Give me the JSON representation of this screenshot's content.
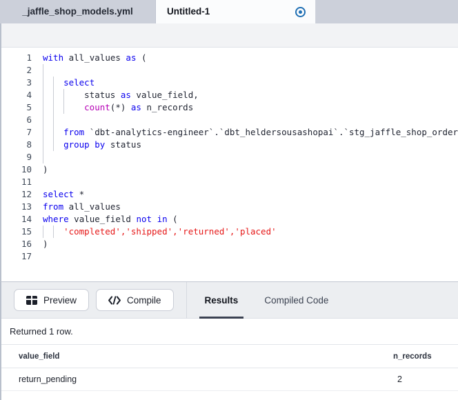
{
  "tabs": [
    {
      "label": "_jaffle_shop_models.yml",
      "active": false,
      "dirty": false
    },
    {
      "label": "Untitled-1",
      "active": true,
      "dirty": true,
      "dirty_icon": "unsaved-dot-icon"
    }
  ],
  "editor": {
    "language": "sql",
    "lines": [
      {
        "n": "1",
        "tokens": [
          {
            "t": "with",
            "c": "k"
          },
          {
            "t": " all_values ",
            "c": "p"
          },
          {
            "t": "as",
            "c": "k"
          },
          {
            "t": " (",
            "c": "p"
          }
        ],
        "indent": 0,
        "guides": []
      },
      {
        "n": "2",
        "tokens": [],
        "indent": 0,
        "guides": [
          0
        ]
      },
      {
        "n": "3",
        "tokens": [
          {
            "t": "select",
            "c": "k"
          }
        ],
        "indent": 4,
        "guides": [
          0,
          2
        ]
      },
      {
        "n": "4",
        "tokens": [
          {
            "t": "status ",
            "c": "p"
          },
          {
            "t": "as",
            "c": "k"
          },
          {
            "t": " value_field,",
            "c": "p"
          }
        ],
        "indent": 8,
        "guides": [
          0,
          2,
          4
        ]
      },
      {
        "n": "5",
        "tokens": [
          {
            "t": "count",
            "c": "fn"
          },
          {
            "t": "(*) ",
            "c": "p"
          },
          {
            "t": "as",
            "c": "k"
          },
          {
            "t": " n_records",
            "c": "p"
          }
        ],
        "indent": 8,
        "guides": [
          0,
          2,
          4
        ]
      },
      {
        "n": "6",
        "tokens": [],
        "indent": 0,
        "guides": [
          0,
          2
        ]
      },
      {
        "n": "7",
        "tokens": [
          {
            "t": "from",
            "c": "k"
          },
          {
            "t": " `dbt-analytics-engineer`.`dbt_heldersousashopai`.`stg_jaffle_shop_orders`",
            "c": "p"
          }
        ],
        "indent": 4,
        "guides": [
          0,
          2
        ]
      },
      {
        "n": "8",
        "tokens": [
          {
            "t": "group by",
            "c": "k"
          },
          {
            "t": " status",
            "c": "p"
          }
        ],
        "indent": 4,
        "guides": [
          0,
          2
        ]
      },
      {
        "n": "9",
        "tokens": [],
        "indent": 0,
        "guides": [
          0
        ]
      },
      {
        "n": "10",
        "tokens": [
          {
            "t": ")",
            "c": "p"
          }
        ],
        "indent": 0,
        "guides": []
      },
      {
        "n": "11",
        "tokens": [],
        "indent": 0,
        "guides": []
      },
      {
        "n": "12",
        "tokens": [
          {
            "t": "select",
            "c": "k"
          },
          {
            "t": " *",
            "c": "p"
          }
        ],
        "indent": 0,
        "guides": []
      },
      {
        "n": "13",
        "tokens": [
          {
            "t": "from",
            "c": "k"
          },
          {
            "t": " all_values",
            "c": "p"
          }
        ],
        "indent": 0,
        "guides": []
      },
      {
        "n": "14",
        "tokens": [
          {
            "t": "where",
            "c": "k"
          },
          {
            "t": " value_field ",
            "c": "p"
          },
          {
            "t": "not in",
            "c": "k"
          },
          {
            "t": " (",
            "c": "p"
          }
        ],
        "indent": 0,
        "guides": []
      },
      {
        "n": "15",
        "tokens": [
          {
            "t": "'completed','shipped','returned','placed'",
            "c": "s"
          }
        ],
        "indent": 4,
        "guides": [
          0,
          2
        ]
      },
      {
        "n": "16",
        "tokens": [
          {
            "t": ")",
            "c": "p"
          }
        ],
        "indent": 0,
        "guides": []
      },
      {
        "n": "17",
        "tokens": [],
        "indent": 0,
        "guides": []
      }
    ]
  },
  "panel": {
    "buttons": [
      {
        "label": "Preview",
        "icon": "table-icon"
      },
      {
        "label": "Compile",
        "icon": "code-brackets-icon"
      }
    ],
    "tabs": [
      {
        "label": "Results",
        "active": true
      },
      {
        "label": "Compiled Code",
        "active": false
      }
    ],
    "status": "Returned 1 row.",
    "results": {
      "columns": [
        "value_field",
        "n_records"
      ],
      "rows": [
        {
          "value_field": "return_pending",
          "n_records": "2"
        }
      ]
    }
  },
  "colors": {
    "tabbar_bg": "#ccd0da",
    "active_tab_bg": "#fbfcfd",
    "editor_bg": "#ffffff",
    "keyword": "#0a00ee",
    "function": "#b500b5",
    "string": "#e61717",
    "accent_underline": "#3b4252",
    "dirty_dot": "#1f6fb4"
  }
}
